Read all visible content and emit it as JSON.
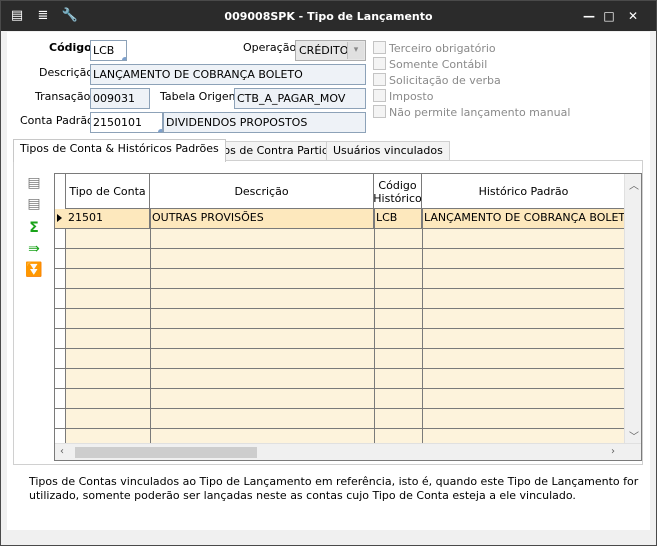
{
  "window": {
    "title": "009008SPK - Tipo de Lançamento",
    "controls": {
      "minimize": "—",
      "maximize": "□",
      "close": "✕"
    }
  },
  "form": {
    "codigo_label": "Código:",
    "codigo_value": "LCB",
    "operacao_label": "Operação:",
    "operacao_value": "CRÉDITO",
    "descricao_label": "Descrição:",
    "descricao_value": "LANÇAMENTO DE COBRANÇA BOLETO",
    "transacao_label": "Transação:",
    "transacao_value": "009031",
    "tabela_origem_label": "Tabela Origem:",
    "tabela_origem_value": "CTB_A_PAGAR_MOV",
    "conta_padrao_label": "Conta Padrão:",
    "conta_padrao_code": "2150101",
    "conta_padrao_desc": "DIVIDENDOS PROPOSTOS"
  },
  "checkboxes": [
    {
      "label": "Terceiro obrigatório",
      "checked": false
    },
    {
      "label": "Somente Contábil",
      "checked": false
    },
    {
      "label": "Solicitação de verba",
      "checked": false
    },
    {
      "label": "Imposto",
      "checked": false
    },
    {
      "label": "Não permite lançamento manual",
      "checked": false
    }
  ],
  "tabs": [
    {
      "label": "Tipos de Conta & Históricos Padrões",
      "active": true
    },
    {
      "label": "Tipos de Contra Partida",
      "active": false
    },
    {
      "label": "Usuários vinculados",
      "active": false
    }
  ],
  "grid": {
    "columns": [
      "Tipo de Conta",
      "Descrição",
      "Código Histórico",
      "Histórico Padrão"
    ],
    "rows": [
      [
        "21501",
        "OUTRAS PROVISÕES",
        "LCB",
        "LANÇAMENTO DE COBRANÇA BOLETO"
      ]
    ]
  },
  "footer": {
    "text": "Tipos de Contas vinculados ao Tipo de Lançamento em referência, isto é, quando este Tipo de Lançamento for utilizado, somente poderão ser lançadas neste as contas cujo Tipo de Conta esteja a ele vinculado."
  },
  "colors": {
    "titlebar": "#2b2b2b",
    "grid_row": "#fde8bd",
    "grid_bg": "#fdf3dc",
    "field_border": "#8da2b8"
  }
}
